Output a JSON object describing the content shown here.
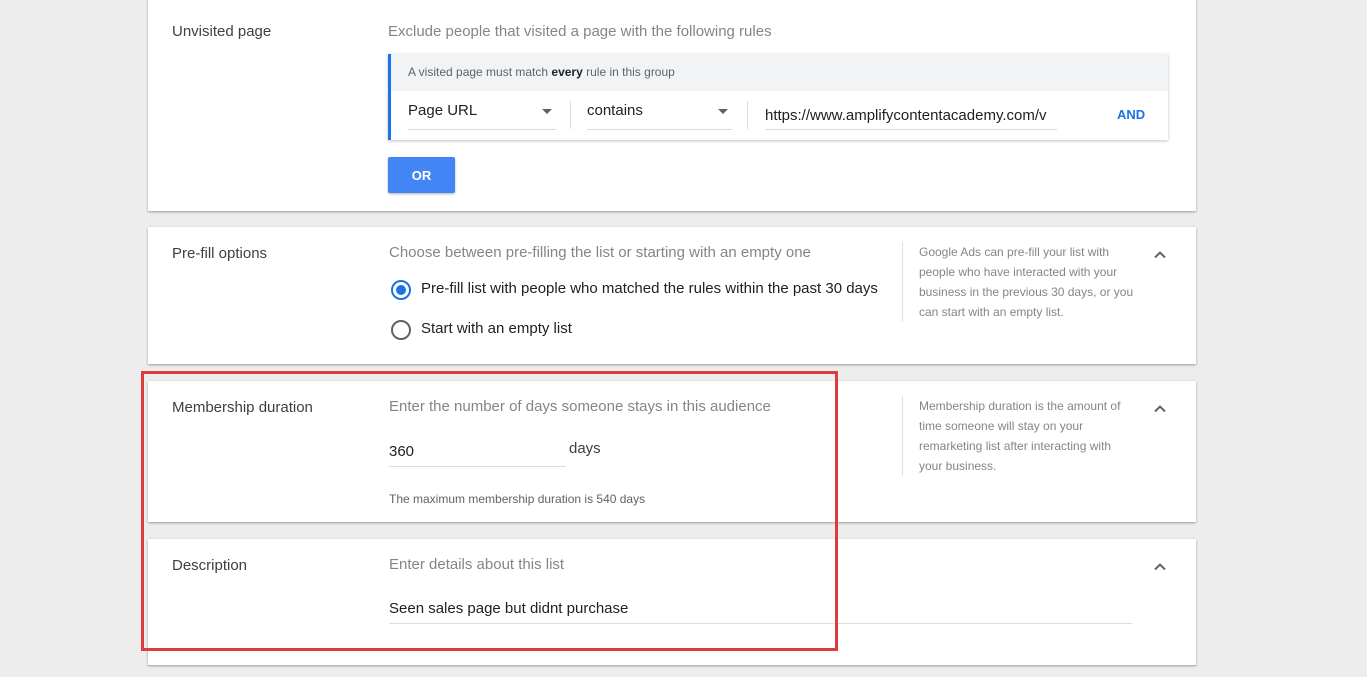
{
  "unvisited": {
    "label": "Unvisited page",
    "hint": "Exclude people that visited a page with the following rules",
    "rule_group": {
      "header_prefix": "A visited page must match ",
      "header_bold": "every",
      "header_suffix": " rule in this group",
      "field": "Page URL",
      "operator": "contains",
      "value": "https://www.amplifycontentacademy.com/v",
      "and_label": "AND"
    },
    "or_label": "OR"
  },
  "prefill": {
    "label": "Pre-fill options",
    "hint": "Choose between pre-filling the list or starting with an empty one",
    "options": [
      {
        "label": "Pre-fill list with people who matched the rules within the past 30 days",
        "selected": true
      },
      {
        "label": "Start with an empty list",
        "selected": false
      }
    ],
    "help": "Google Ads can pre-fill your list with people who have interacted with your business in the previous 30 days, or you can start with an empty list."
  },
  "membership": {
    "label": "Membership duration",
    "hint": "Enter the number of days someone stays in this audience",
    "value": "360",
    "suffix": "days",
    "note": "The maximum membership duration is 540 days",
    "help": "Membership duration is the amount of time someone will stay on your remarketing list after interacting with your business."
  },
  "description": {
    "label": "Description",
    "hint": "Enter details about this list",
    "value": "Seen sales page but didnt purchase"
  },
  "colors": {
    "accent": "#1a73e8",
    "or_button": "#4285f4",
    "highlight": "#e0393e"
  }
}
